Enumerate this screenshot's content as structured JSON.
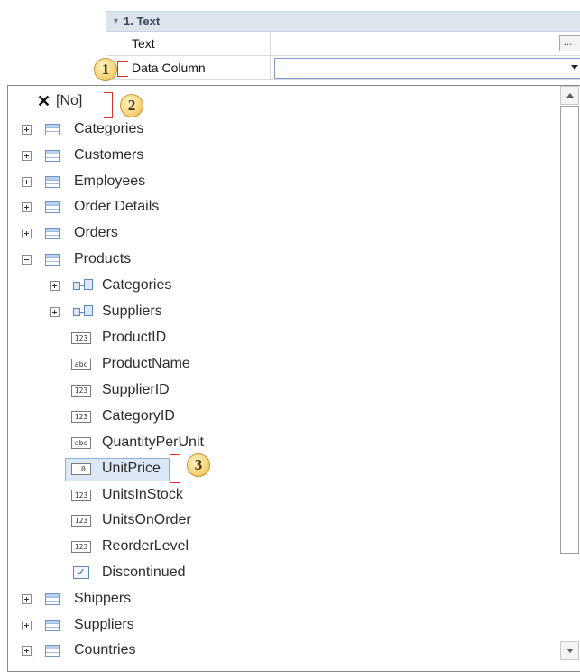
{
  "property_grid": {
    "category": "1. Text",
    "rows": [
      {
        "name": "Text",
        "value_button": "..."
      },
      {
        "name": "Data Column",
        "value": ""
      }
    ]
  },
  "callouts": [
    "1",
    "2",
    "3"
  ],
  "tree": {
    "none_item": "[No]",
    "tables": [
      {
        "label": "Categories"
      },
      {
        "label": "Customers"
      },
      {
        "label": "Employees"
      },
      {
        "label": "Order Details"
      },
      {
        "label": "Orders"
      },
      {
        "label": "Products"
      }
    ],
    "products_children": {
      "relations": [
        {
          "label": "Categories"
        },
        {
          "label": "Suppliers"
        }
      ],
      "fields": [
        {
          "label": "ProductID",
          "type": "123"
        },
        {
          "label": "ProductName",
          "type": "abc"
        },
        {
          "label": "SupplierID",
          "type": "123"
        },
        {
          "label": "CategoryID",
          "type": "123"
        },
        {
          "label": "QuantityPerUnit",
          "type": "abc"
        },
        {
          "label": "UnitPrice",
          "type": ".0"
        },
        {
          "label": "UnitsInStock",
          "type": "123"
        },
        {
          "label": "UnitsOnOrder",
          "type": "123"
        },
        {
          "label": "ReorderLevel",
          "type": "123"
        },
        {
          "label": "Discontinued",
          "type": "✓"
        }
      ]
    },
    "tables_after": [
      {
        "label": "Shippers"
      },
      {
        "label": "Suppliers"
      },
      {
        "label": "Countries"
      }
    ]
  },
  "colors": {
    "selection": "#dbe7f5",
    "highlight": "#d9302a",
    "category_band": "#dde4ee"
  }
}
